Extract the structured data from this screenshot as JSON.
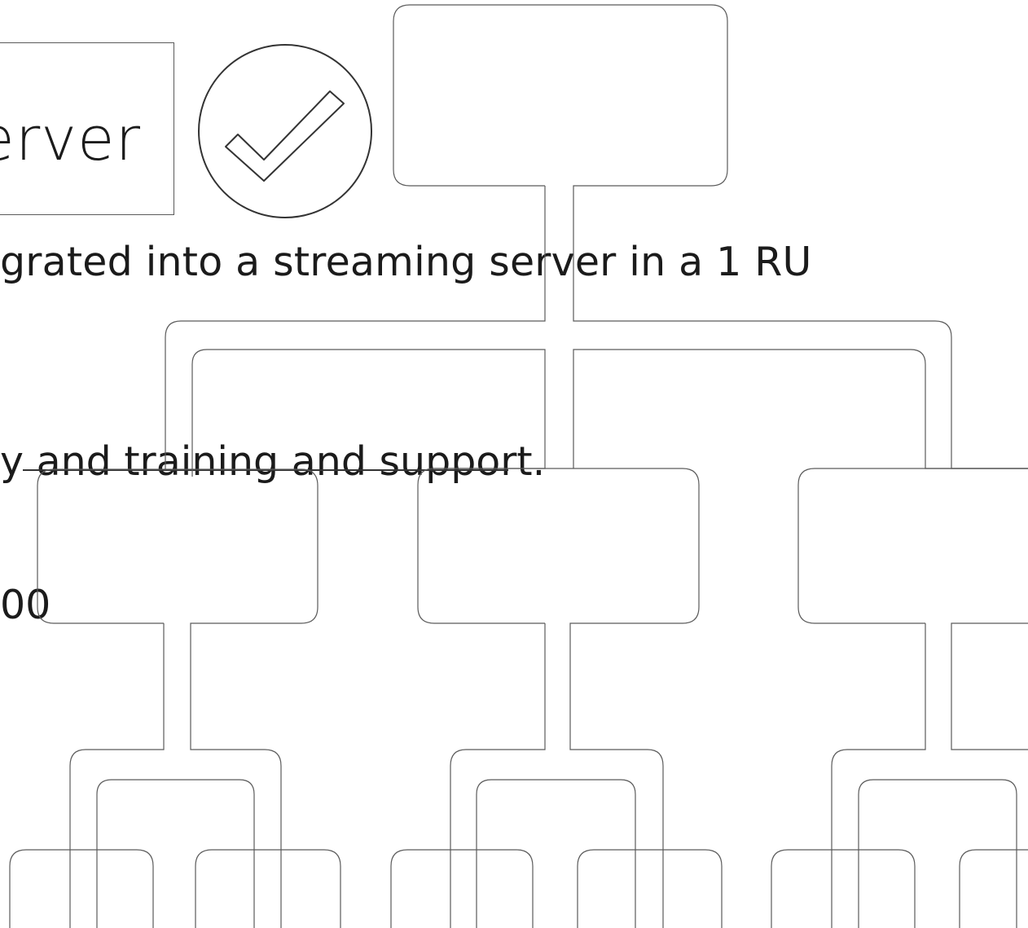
{
  "title": "erver",
  "lines": {
    "line1": "grated into a streaming server in a 1 RU",
    "line2": "y and training and support.",
    "line3": "00"
  },
  "icons": {
    "check": "checkmark-circle-icon"
  },
  "colors": {
    "stroke": "#5a5a5a",
    "text": "#1b1b1b",
    "background": "#ffffff"
  }
}
